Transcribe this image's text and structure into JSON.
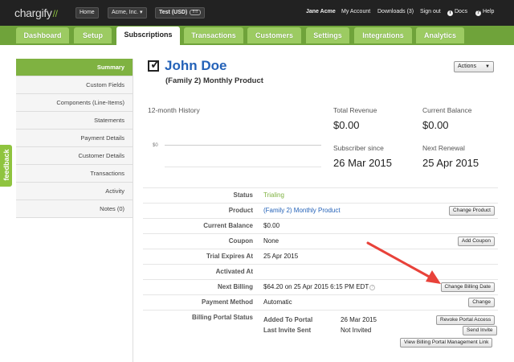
{
  "topbar": {
    "logo": "chargify",
    "home": "Home",
    "site": "Acme, Inc.",
    "env": "Test (USD)",
    "user": "Jane Acme",
    "my_account": "My Account",
    "downloads": "Downloads (3)",
    "sign_out": "Sign out",
    "docs": "Docs",
    "help": "Help"
  },
  "nav": {
    "tabs": [
      "Dashboard",
      "Setup",
      "Subscriptions",
      "Transactions",
      "Customers",
      "Settings",
      "Integrations",
      "Analytics"
    ],
    "active": "Subscriptions"
  },
  "sidebar": {
    "items": [
      "Summary",
      "Custom Fields",
      "Components (Line-Items)",
      "Statements",
      "Payment Details",
      "Customer Details",
      "Transactions",
      "Activity",
      "Notes (0)"
    ],
    "active": "Summary"
  },
  "feedback": "feedback",
  "header": {
    "name": "John Doe",
    "product": "(Family 2) Monthly Product",
    "actions": "Actions"
  },
  "history": {
    "title": "12-month History",
    "y_tick": "$0"
  },
  "metrics": {
    "total_revenue_label": "Total Revenue",
    "total_revenue": "$0.00",
    "current_balance_label": "Current Balance",
    "current_balance": "$0.00",
    "subscriber_since_label": "Subscriber since",
    "subscriber_since": "26 Mar 2015",
    "next_renewal_label": "Next Renewal",
    "next_renewal": "25 Apr 2015"
  },
  "details": {
    "status_label": "Status",
    "status": "Trialing",
    "product_label": "Product",
    "product": "(Family 2) Monthly Product",
    "change_product": "Change Product",
    "balance_label": "Current Balance",
    "balance": "$0.00",
    "coupon_label": "Coupon",
    "coupon": "None",
    "add_coupon": "Add Coupon",
    "trial_label": "Trial Expires At",
    "trial": "25 Apr 2015",
    "activated_label": "Activated At",
    "next_billing_label": "Next Billing",
    "next_billing": "$64.20 on 25 Apr 2015 6:15 PM EDT",
    "change_billing": "Change Billing Date",
    "payment_label": "Payment Method",
    "payment": "Automatic",
    "change": "Change",
    "portal_label": "Billing Portal Status",
    "added_label": "Added To Portal",
    "added": "26 Mar 2015",
    "revoke": "Revoke Portal Access",
    "invite_label": "Last Invite Sent",
    "invite": "Not Invited",
    "send_invite": "Send Invite",
    "view_portal": "View Billing Portal Management Link"
  },
  "colors": {
    "brand_green": "#7fb241",
    "nav_green": "#6fa33a",
    "link_blue": "#2462b8",
    "arrow_red": "#e8423a"
  }
}
